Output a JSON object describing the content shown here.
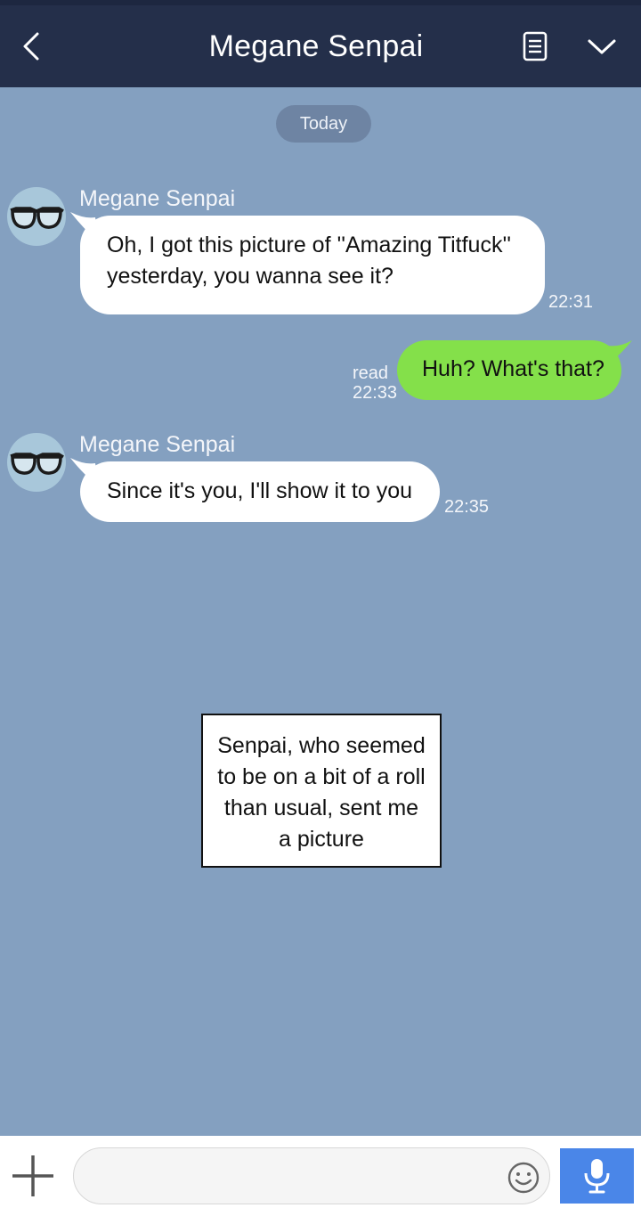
{
  "header": {
    "title": "Megane Senpai",
    "back_icon": "chevron-left-icon",
    "notes_icon": "notes-icon",
    "menu_icon": "chevron-down-icon"
  },
  "date_separator": "Today",
  "messages": [
    {
      "direction": "incoming",
      "sender": "Megane Senpai",
      "lines": [
        "Oh, I got this picture of ''Amazing Titfuck''",
        "yesterday, you wanna see it?"
      ],
      "time": "22:31"
    },
    {
      "direction": "outgoing",
      "lines": [
        "Huh? What's that?"
      ],
      "status": "read",
      "time": "22:33"
    },
    {
      "direction": "incoming",
      "sender": "Megane Senpai",
      "lines": [
        "Since it's you, I'll show it to you"
      ],
      "time": "22:35"
    }
  ],
  "narration": {
    "lines": [
      "Senpai, who seemed",
      "to be on a bit of a roll",
      "than usual, sent me",
      "a picture"
    ]
  },
  "input_bar": {
    "message_value": "",
    "plus_icon": "plus-icon",
    "emoji_icon": "smiley-icon",
    "mic_icon": "microphone-icon"
  },
  "colors": {
    "header_bg": "#242f4a",
    "chat_bg": "#84a0c0",
    "incoming_bubble": "#ffffff",
    "outgoing_bubble": "#84e04a",
    "mic_button": "#4a86e8"
  }
}
